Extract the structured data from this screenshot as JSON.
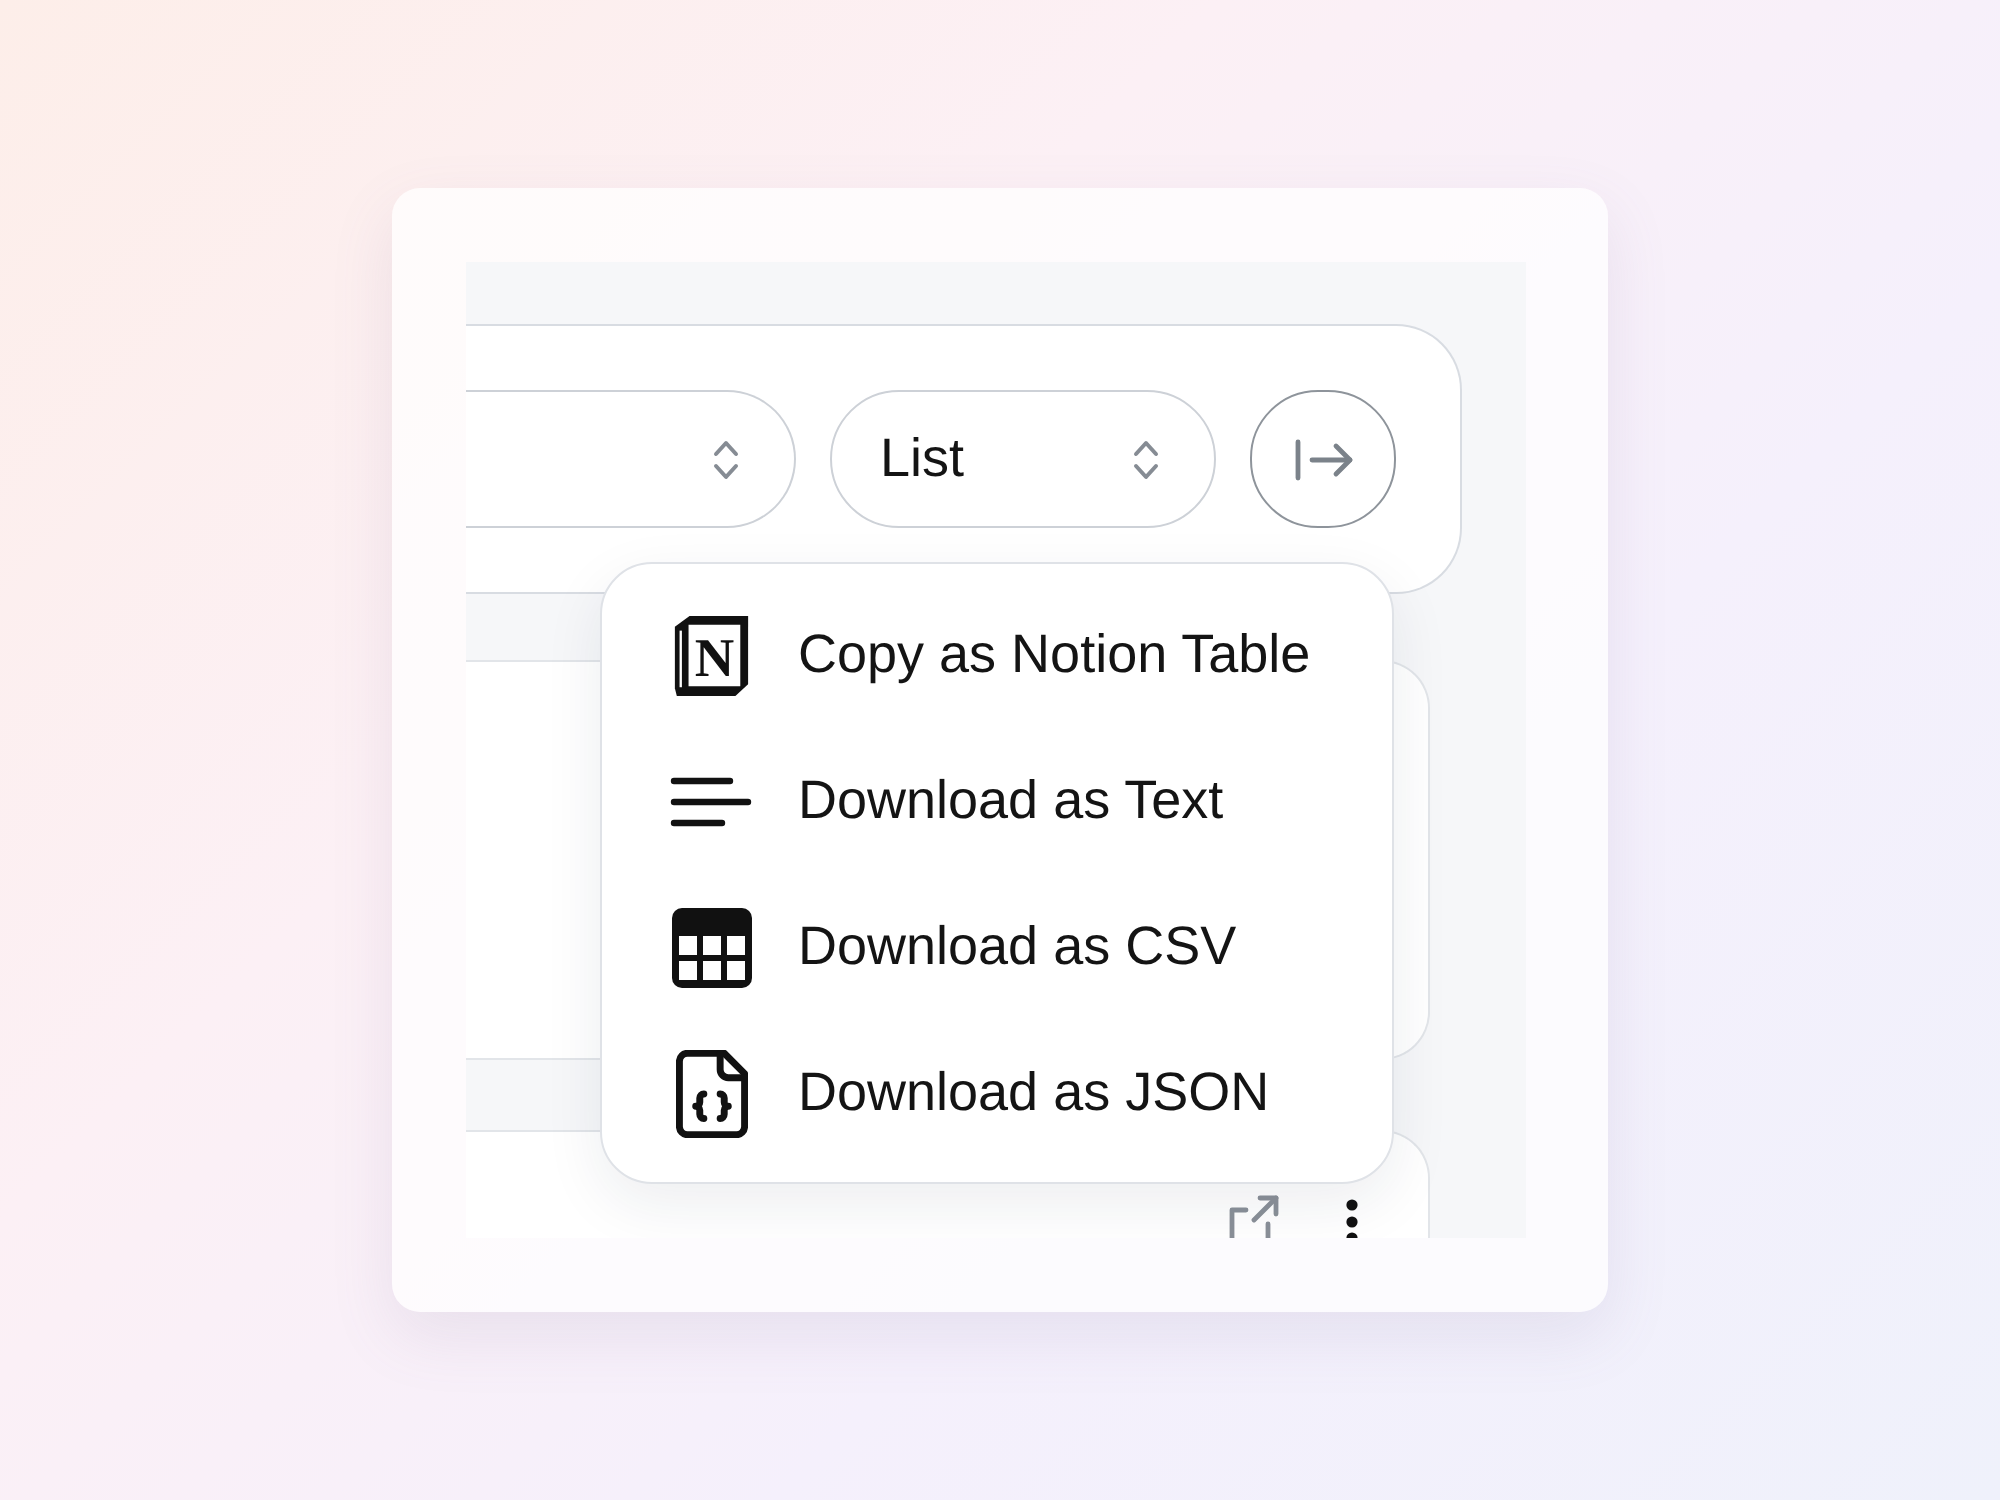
{
  "toolbar": {
    "controls": [
      {
        "kind": "select"
      },
      {
        "kind": "select",
        "value": "List"
      },
      {
        "kind": "icon_button"
      }
    ]
  },
  "menu": {
    "items": [
      {
        "kind": "notion",
        "label": "Copy as Notion Table",
        "logo_text": "N"
      },
      {
        "kind": "text",
        "label": "Download as Text"
      },
      {
        "kind": "csv",
        "label": "Download as CSV"
      },
      {
        "kind": "json",
        "label": "Download as JSON"
      }
    ]
  }
}
